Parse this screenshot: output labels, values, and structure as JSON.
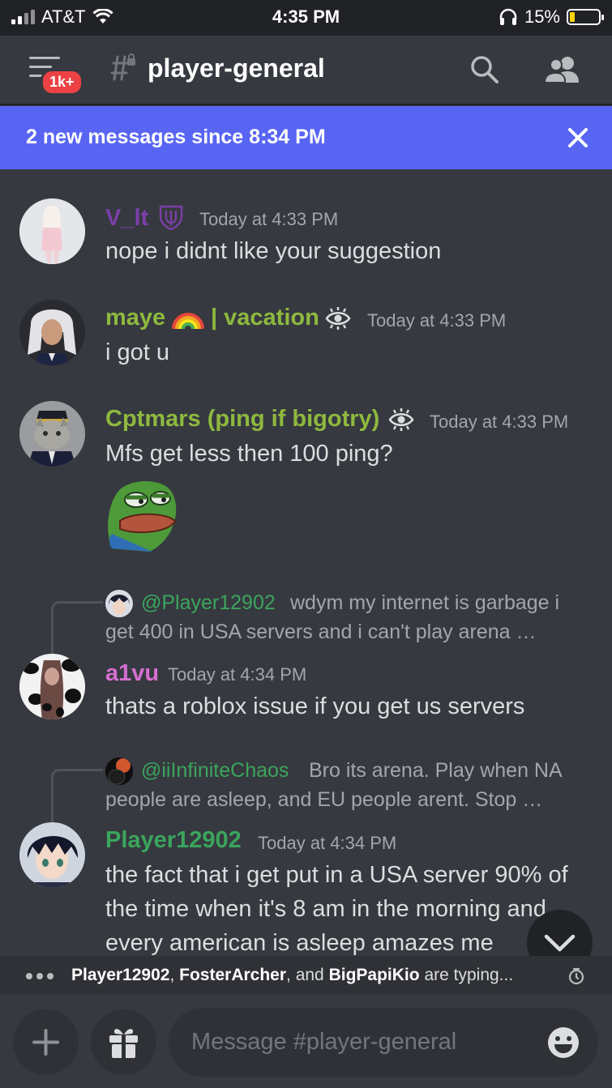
{
  "status_bar": {
    "carrier": "AT&T",
    "time": "4:35 PM",
    "battery": "15%"
  },
  "header": {
    "badge": "1k+",
    "channel": "player-general"
  },
  "new_messages": {
    "text": "2 new messages since 8:34 PM"
  },
  "messages": [
    {
      "username": "V_lt",
      "color": "#7b3fa8",
      "timestamp": "Today at 4:33 PM",
      "lines": [
        "nope i didnt like your suggestion"
      ]
    },
    {
      "username": "maye",
      "username_suffix": "| vacation",
      "color": "#8eb93f",
      "timestamp": "Today at 4:33 PM",
      "lines": [
        "i got u"
      ]
    },
    {
      "username": "Cptmars (ping if bigotry)",
      "color": "#8eb93f",
      "timestamp": "Today at 4:33 PM",
      "lines": [
        "Mfs get less then 100 ping?"
      ]
    },
    {
      "username": "a1vu",
      "color": "#d56fd1",
      "timestamp": "Today at 4:34 PM",
      "lines": [
        "thats a roblox issue if you get us servers"
      ],
      "reply": {
        "mention": "@Player12902",
        "line1": "wdym my internet is garbage i",
        "line2": "get 400 in USA servers and i can't play arena …"
      }
    },
    {
      "username": "Player12902",
      "color": "#3ba55d",
      "timestamp": "Today at 4:34 PM",
      "lines": [
        "the fact that i get put in a USA server 90% of",
        "the time when it's 8 am in the morning and",
        "every american is asleep amazes me"
      ],
      "reply": {
        "mention": "@iiInfiniteChaos",
        "line1": "Bro its arena. Play when NA",
        "line2": "people are asleep, and EU people arent. Stop …"
      }
    }
  ],
  "typing": {
    "user1": "Player12902",
    "sep1": ",",
    "user2": "FosterArcher",
    "sep2": ", and",
    "user3": "BigPapiKio",
    "suffix": "are typing..."
  },
  "composer": {
    "placeholder": "Message #player-general"
  },
  "colors": {
    "background": "#36393f",
    "accent": "#5865f2",
    "badge": "#ed4245"
  }
}
